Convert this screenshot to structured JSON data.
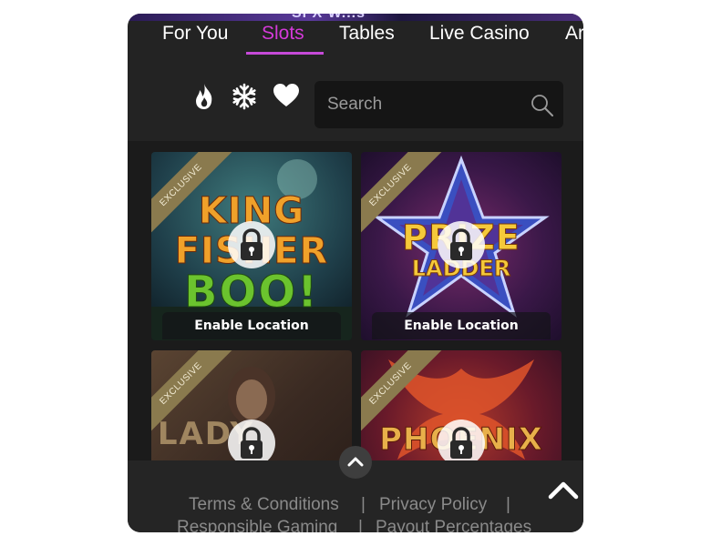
{
  "banner": {
    "peek_text": "SFX W...s"
  },
  "tabs": [
    {
      "label": "For You",
      "active": false
    },
    {
      "label": "Slots",
      "active": true
    },
    {
      "label": "Tables",
      "active": false
    },
    {
      "label": "Live Casino",
      "active": false
    },
    {
      "label": "Ar",
      "active": false
    }
  ],
  "filters": [
    {
      "icon": "flame-icon"
    },
    {
      "icon": "snowflake-icon"
    },
    {
      "icon": "heart-icon"
    }
  ],
  "search": {
    "placeholder": "Search",
    "value": ""
  },
  "games": [
    {
      "title_line1": "KING",
      "title_line2": "FISHER",
      "title_line3": "BOO!",
      "badge": "EXCLUSIVE",
      "action": "Enable Location"
    },
    {
      "title_line1": "PRIZE",
      "title_line2": "LADDER",
      "title_line3": "",
      "badge": "EXCLUSIVE",
      "action": "Enable Location"
    },
    {
      "title_line1": "LADY",
      "title_line2": "",
      "title_line3": "",
      "badge": "EXCLUSIVE",
      "action": ""
    },
    {
      "title_line1": "PHOENIX",
      "title_line2": "",
      "title_line3": "",
      "badge": "EXCLUSIVE",
      "action": ""
    }
  ],
  "footer": {
    "links": [
      "Terms & Conditions",
      "Privacy Policy",
      "Responsible Gaming",
      "Payout Percentages"
    ],
    "separator": "|"
  },
  "colors": {
    "accent": "#c64ad8",
    "panel": "#232323",
    "grid_bg": "#1b1b1b",
    "footer_text": "#8a8a8a"
  }
}
